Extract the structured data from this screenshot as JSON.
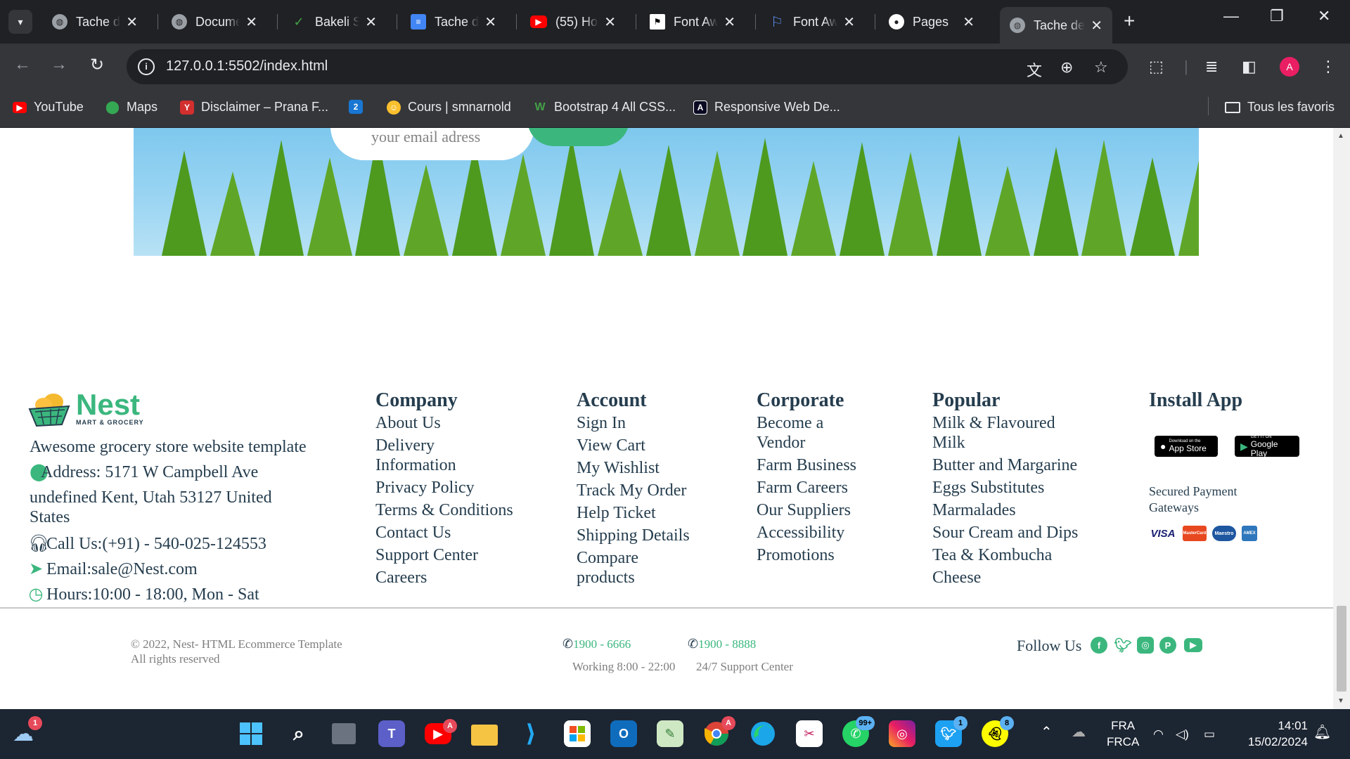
{
  "browser": {
    "tabs": [
      {
        "label": "Tache de",
        "icon": "globe-icon",
        "color": "#9aa0a6"
      },
      {
        "label": "Document",
        "icon": "globe-icon",
        "color": "#9aa0a6"
      },
      {
        "label": "Bakeli Sc",
        "icon": "bakeli-icon",
        "color": "#2e7d32"
      },
      {
        "label": "Tache de",
        "icon": "docs-icon",
        "color": "#4285f4"
      },
      {
        "label": "(55) Ho",
        "icon": "youtube-icon",
        "color": "#ff0000"
      },
      {
        "label": "Font Aw",
        "icon": "flag-icon",
        "color": "#ffffff"
      },
      {
        "label": "Font Aw",
        "icon": "flag-outline-icon",
        "color": "#5b8def"
      },
      {
        "label": "Pages",
        "icon": "github-icon",
        "color": "#ffffff"
      },
      {
        "label": "Tache de",
        "icon": "globe-icon",
        "color": "#9aa0a6"
      }
    ],
    "url": "127.0.0.1:5502/index.html",
    "profile_initial": "A",
    "bookmarks": [
      {
        "label": "YouTube",
        "icon": "youtube-icon",
        "color": "#ff0000"
      },
      {
        "label": "Maps",
        "icon": "maps-icon",
        "color": "#34a853"
      },
      {
        "label": "Disclaimer – Prana F...",
        "icon": "prana-icon",
        "color": "#d32f2f"
      },
      {
        "label": "",
        "icon": "number-two-icon",
        "color": "#1976d2",
        "glyph": "2"
      },
      {
        "label": "Cours | smnarnold",
        "icon": "smile-icon",
        "color": "#fbc02d"
      },
      {
        "label": "Bootstrap 4 All CSS...",
        "icon": "w-icon",
        "color": "#43a047"
      },
      {
        "label": "Responsive Web De...",
        "icon": "fcc-icon",
        "color": "#0a0a23"
      }
    ],
    "all_bookmarks": "Tous les favoris"
  },
  "page": {
    "newsletter_placeholder": "your email adress",
    "logo": {
      "name": "Nest",
      "sub": "MART & GROCERY"
    },
    "about": {
      "tagline": "Awesome grocery store website template",
      "address_1": "Address: 5171 W Campbell Ave",
      "address_2": "undefined Kent, Utah 53127 United",
      "address_3": "States",
      "call": "Call Us:(+91) - 540-025-124553",
      "email": "Email:sale@Nest.com",
      "hours": "Hours:10:00 - 18:00, Mon - Sat"
    },
    "columns": [
      {
        "title": "Company",
        "links": [
          "About Us",
          "Delivery Information",
          "Privacy Policy",
          "Terms & Conditions",
          "Contact Us",
          "Support Center",
          "Careers"
        ]
      },
      {
        "title": "Account",
        "links": [
          "Sign In",
          "View Cart",
          "My Wishlist",
          "Track My Order",
          "Help Ticket",
          "Shipping Details",
          "Compare products"
        ]
      },
      {
        "title": "Corporate",
        "links": [
          "Become a Vendor",
          "Farm Business",
          "Farm Careers",
          "Our Suppliers",
          "Accessibility",
          "Promotions"
        ]
      },
      {
        "title": "Popular",
        "links": [
          "Milk & Flavoured Milk",
          "Butter and Margarine",
          "Eggs Substitutes",
          "Marmalades",
          "Sour Cream and Dips",
          "Tea & Kombucha",
          "Cheese"
        ]
      }
    ],
    "install": {
      "title": "Install App",
      "app_store_small": "Download on the",
      "app_store_big": "App Store",
      "google_small": "GET IT ON",
      "google_big": "Google Play",
      "payment_label": "Secured Payment Gateways",
      "cards": [
        "VISA",
        "MasterCard",
        "Maestro",
        "AMEX"
      ]
    },
    "bottom": {
      "copyright_1": "© 2022, Nest- HTML Ecommerce Template",
      "copyright_2": "All rights reserved",
      "phone_1": "1900 - 6666",
      "phone_1_sub": "Working 8:00 - 22:00",
      "phone_2": "1900 - 8888",
      "phone_2_sub": "24/7 Support Center",
      "follow": "Follow Us"
    },
    "accent_color": "#3bb77e"
  },
  "taskbar": {
    "weather_badge": "1",
    "youtube_badge": "A",
    "chrome_badge": "A",
    "whatsapp_badge": "99+",
    "twitter_badge": "1",
    "snap_badge": "8",
    "lang_1": "FRA",
    "lang_2": "FRCA",
    "time": "14:01",
    "date": "15/02/2024"
  }
}
